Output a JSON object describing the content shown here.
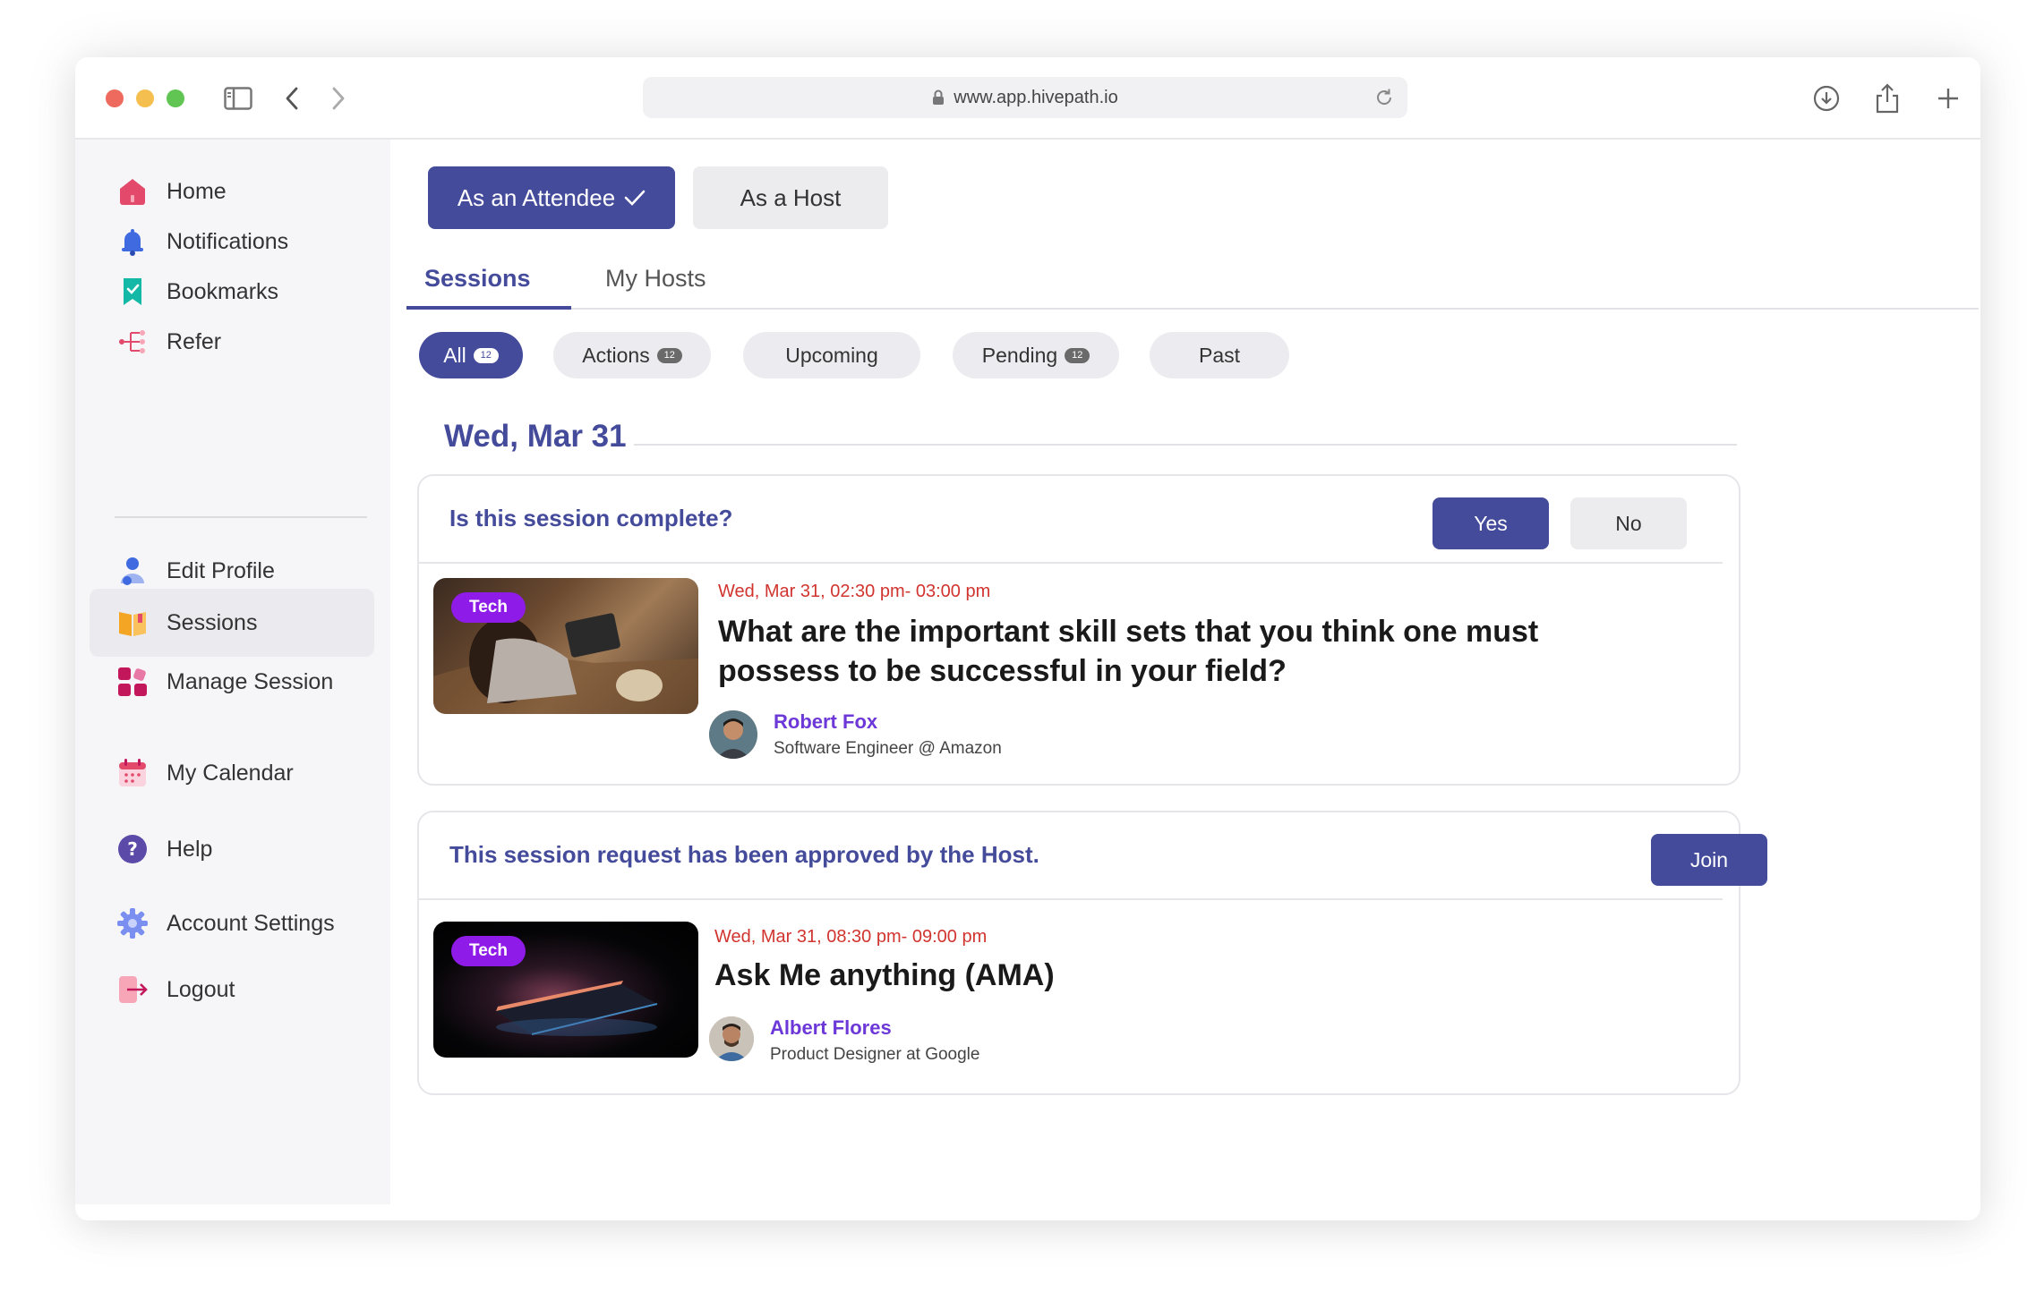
{
  "browser": {
    "url": "www.app.hivepath.io"
  },
  "sidebar": {
    "items": [
      {
        "label": "Home",
        "icon": "home-icon"
      },
      {
        "label": "Notifications",
        "icon": "bell-icon"
      },
      {
        "label": "Bookmarks",
        "icon": "bookmark-icon"
      },
      {
        "label": "Refer",
        "icon": "refer-icon"
      },
      {
        "label": "Edit Profile",
        "icon": "user-icon"
      },
      {
        "label": "Sessions",
        "icon": "book-icon"
      },
      {
        "label": "Manage Session",
        "icon": "grid-icon"
      },
      {
        "label": "My Calendar",
        "icon": "calendar-icon"
      },
      {
        "label": "Help",
        "icon": "help-icon"
      },
      {
        "label": "Account Settings",
        "icon": "gear-icon"
      },
      {
        "label": "Logout",
        "icon": "logout-icon"
      }
    ],
    "active": "Sessions"
  },
  "roles": {
    "attendee": "As an Attendee",
    "host": "As a Host"
  },
  "tabs": {
    "sessions": "Sessions",
    "hosts": "My Hosts"
  },
  "filters": [
    {
      "label": "All",
      "badge": "12"
    },
    {
      "label": "Actions",
      "badge": "12"
    },
    {
      "label": "Upcoming"
    },
    {
      "label": "Pending",
      "badge": "12"
    },
    {
      "label": "Past"
    }
  ],
  "date_heading": "Wed, Mar 31",
  "cards": [
    {
      "question": "Is this session complete?",
      "yes_label": "Yes",
      "no_label": "No",
      "tag": "Tech",
      "when": "Wed, Mar 31, 02:30 pm- 03:00 pm",
      "title": "What are the important skill sets that you think one must possess to be successful in your field?",
      "host_name": "Robert Fox",
      "host_role": "Software Engineer @ Amazon"
    },
    {
      "question": "This session request has been approved by the Host.",
      "join_label": "Join",
      "tag": "Tech",
      "when": "Wed, Mar 31, 08:30 pm- 09:00 pm",
      "title": "Ask Me anything (AMA)",
      "host_name": "Albert Flores",
      "host_role": "Product Designer at Google"
    }
  ],
  "colors": {
    "accent": "#454b9b",
    "time_red": "#d1342f",
    "tag_purple": "#8e1be8",
    "host_purple": "#6d38d8"
  }
}
